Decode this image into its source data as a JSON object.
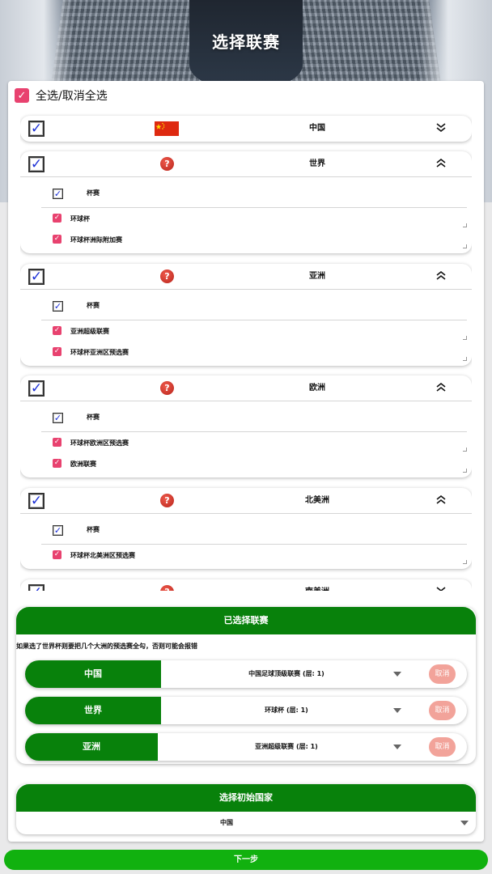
{
  "header": {
    "title": "选择联赛"
  },
  "select_all": {
    "label": "全选/取消全选"
  },
  "regions": [
    {
      "name": "中国",
      "expanded": false,
      "icon": "china-flag-icon",
      "groups": []
    },
    {
      "name": "世界",
      "expanded": true,
      "icon": "help-icon",
      "groups": [
        {
          "label": "杯赛",
          "leagues": [
            "环球杯",
            "环球杯洲际附加赛"
          ]
        }
      ]
    },
    {
      "name": "亚洲",
      "expanded": true,
      "icon": "help-icon",
      "groups": [
        {
          "label": "杯赛",
          "leagues": [
            "亚洲超级联赛",
            "环球杯亚洲区预选赛"
          ]
        }
      ]
    },
    {
      "name": "欧洲",
      "expanded": true,
      "icon": "help-icon",
      "groups": [
        {
          "label": "杯赛",
          "leagues": [
            "环球杯欧洲区预选赛",
            "欧洲联赛"
          ]
        }
      ]
    },
    {
      "name": "北美洲",
      "expanded": true,
      "icon": "help-icon",
      "groups": [
        {
          "label": "杯赛",
          "leagues": [
            "环球杯北美洲区预选赛"
          ]
        }
      ]
    },
    {
      "name": "南美洲",
      "expanded": false,
      "icon": "help-icon",
      "groups": []
    }
  ],
  "selected": {
    "title": "已选择联赛",
    "warning": "如果选了世界杯则要把几个大洲的预选赛全勾，否则可能会报错",
    "rows": [
      {
        "country": "中国",
        "league": "中国足球顶级联赛 (层: 1)",
        "cancel": "取消"
      },
      {
        "country": "世界",
        "league": "环球杯 (层: 1)",
        "cancel": "取消"
      },
      {
        "country": "亚洲",
        "league": "亚洲超级联赛 (层: 1)",
        "cancel": "取消"
      }
    ]
  },
  "initial_country": {
    "title": "选择初始国家",
    "value": "中国"
  },
  "next": {
    "label": "下一步"
  },
  "colors": {
    "green": "#08810b",
    "next_green": "#11b10f",
    "pink": "#e8426f",
    "cancel": "#f2a39a",
    "check_blue": "#1b2fd6"
  }
}
